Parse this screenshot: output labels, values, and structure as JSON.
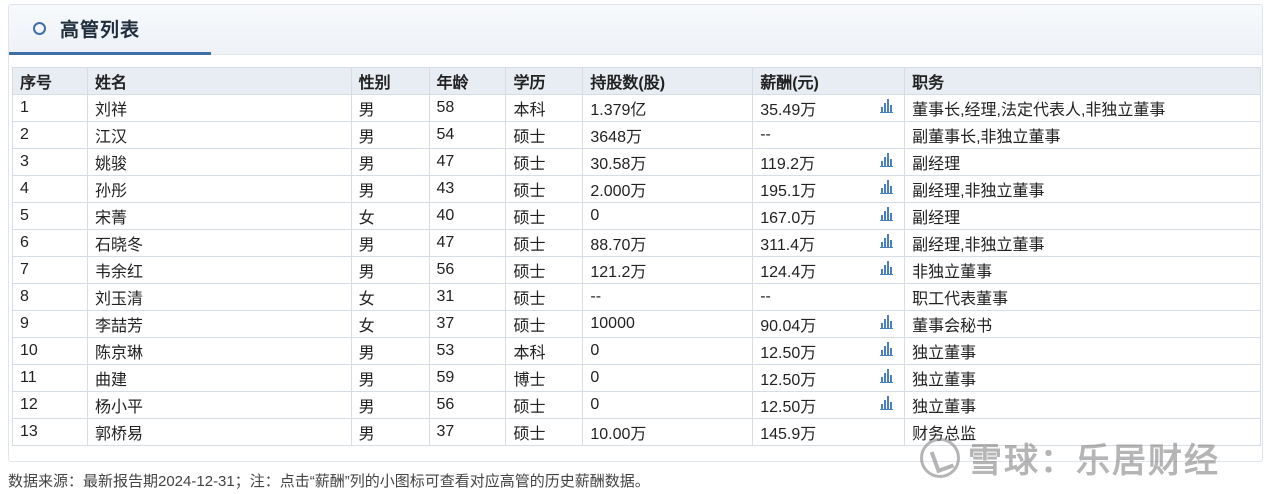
{
  "panel": {
    "title": "高管列表"
  },
  "table": {
    "headers": [
      "序号",
      "姓名",
      "性别",
      "年龄",
      "学历",
      "持股数(股)",
      "薪酬(元)",
      "职务"
    ],
    "rows": [
      {
        "no": "1",
        "name": "刘祥",
        "gender": "男",
        "age": "58",
        "edu": "本科",
        "shares": "1.379亿",
        "pay": "35.49万",
        "has_chart": true,
        "title": "董事长,经理,法定代表人,非独立董事"
      },
      {
        "no": "2",
        "name": "江汉",
        "gender": "男",
        "age": "54",
        "edu": "硕士",
        "shares": "3648万",
        "pay": "--",
        "has_chart": false,
        "title": "副董事长,非独立董事"
      },
      {
        "no": "3",
        "name": "姚骏",
        "gender": "男",
        "age": "47",
        "edu": "硕士",
        "shares": "30.58万",
        "pay": "119.2万",
        "has_chart": true,
        "title": "副经理"
      },
      {
        "no": "4",
        "name": "孙彤",
        "gender": "男",
        "age": "43",
        "edu": "硕士",
        "shares": "2.000万",
        "pay": "195.1万",
        "has_chart": true,
        "title": "副经理,非独立董事"
      },
      {
        "no": "5",
        "name": "宋菁",
        "gender": "女",
        "age": "40",
        "edu": "硕士",
        "shares": "0",
        "pay": "167.0万",
        "has_chart": true,
        "title": "副经理"
      },
      {
        "no": "6",
        "name": "石晓冬",
        "gender": "男",
        "age": "47",
        "edu": "硕士",
        "shares": "88.70万",
        "pay": "311.4万",
        "has_chart": true,
        "title": "副经理,非独立董事"
      },
      {
        "no": "7",
        "name": "韦余红",
        "gender": "男",
        "age": "56",
        "edu": "硕士",
        "shares": "121.2万",
        "pay": "124.4万",
        "has_chart": true,
        "title": "非独立董事"
      },
      {
        "no": "8",
        "name": "刘玉清",
        "gender": "女",
        "age": "31",
        "edu": "硕士",
        "shares": "--",
        "pay": "--",
        "has_chart": false,
        "title": "职工代表董事"
      },
      {
        "no": "9",
        "name": "李喆芳",
        "gender": "女",
        "age": "37",
        "edu": "硕士",
        "shares": "10000",
        "pay": "90.04万",
        "has_chart": true,
        "title": "董事会秘书"
      },
      {
        "no": "10",
        "name": "陈京琳",
        "gender": "男",
        "age": "53",
        "edu": "本科",
        "shares": "0",
        "pay": "12.50万",
        "has_chart": true,
        "title": "独立董事"
      },
      {
        "no": "11",
        "name": "曲建",
        "gender": "男",
        "age": "59",
        "edu": "博士",
        "shares": "0",
        "pay": "12.50万",
        "has_chart": true,
        "title": "独立董事"
      },
      {
        "no": "12",
        "name": "杨小平",
        "gender": "男",
        "age": "56",
        "edu": "硕士",
        "shares": "0",
        "pay": "12.50万",
        "has_chart": true,
        "title": "独立董事"
      },
      {
        "no": "13",
        "name": "郭桥易",
        "gender": "男",
        "age": "37",
        "edu": "硕士",
        "shares": "10.00万",
        "pay": "145.9万",
        "has_chart": false,
        "title": "财务总监"
      }
    ]
  },
  "footer": {
    "note": "数据来源：最新报告期2024-12-31；注：点击“薪酬”列的小图标可查看对应高管的历史薪酬数据。"
  },
  "watermark": {
    "text": "雪球：乐居财经"
  },
  "colors": {
    "accent": "#3f6fa8",
    "header_bg": "#e8edf3",
    "icon": "#4a7fc1"
  }
}
